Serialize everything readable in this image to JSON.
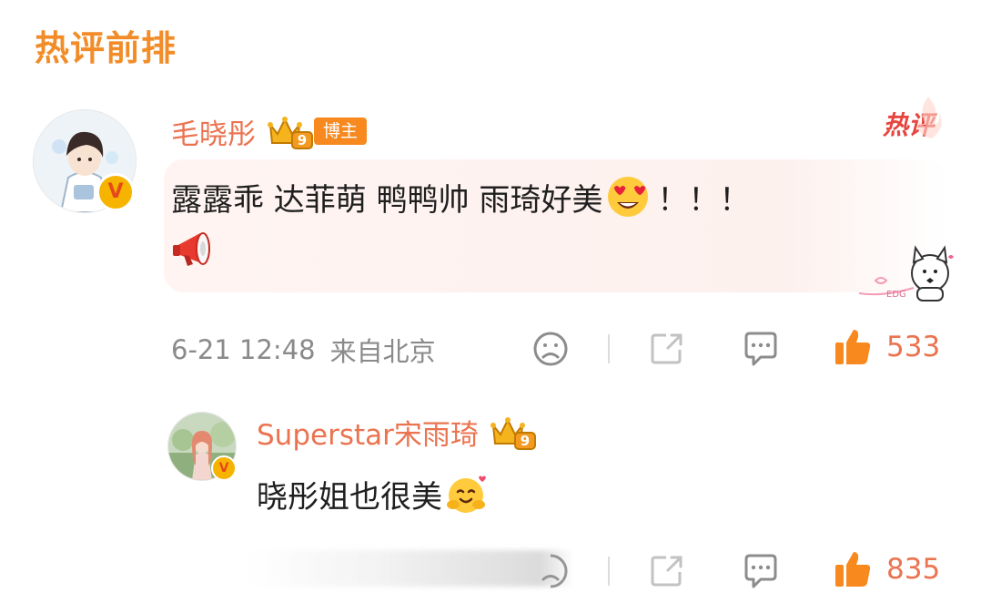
{
  "section": {
    "title": "热评前排"
  },
  "comments": [
    {
      "user_name": "毛晓彤",
      "badge_label": "博主",
      "crown_level": "9",
      "hot_tag": "热评",
      "text": "露露乖 达菲萌 鸭鸭帅 雨琦好美",
      "text_suffix": "！！！",
      "timestamp": "6-21 12:48",
      "location": "来自北京",
      "likes": "533",
      "decoration_caption": "EDG"
    }
  ],
  "reply": {
    "user_name": "Superstar宋雨琦",
    "crown_level": "9",
    "text": "晓彤姐也很美",
    "likes": "835"
  },
  "colors": {
    "accent": "#eb7350",
    "section_title": "#f28c28",
    "hot_tag": "#e6453e",
    "meta": "#8a8a8a"
  },
  "icons": [
    "verified-v-icon",
    "crown-icon",
    "megaphone-icon",
    "heart-eyes-emoji-icon",
    "frown-icon",
    "share-icon",
    "comment-icon",
    "thumbs-up-icon",
    "hug-emoji-icon"
  ]
}
